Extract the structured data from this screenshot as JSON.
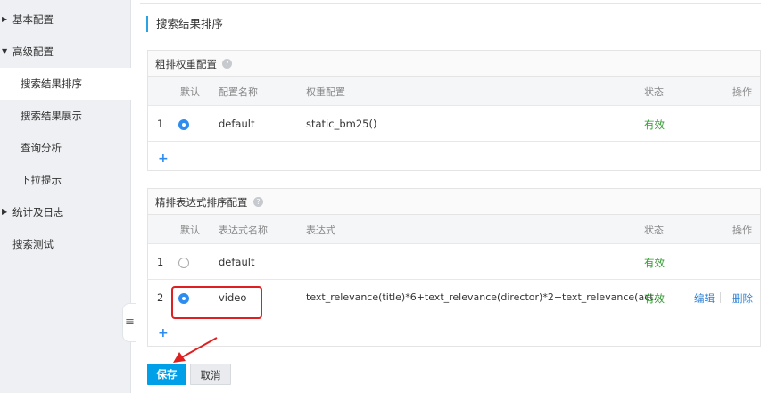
{
  "sidebar": {
    "items": [
      {
        "label": "基本配置"
      },
      {
        "label": "高级配置"
      },
      {
        "label": "搜索结果排序"
      },
      {
        "label": "搜索结果展示"
      },
      {
        "label": "查询分析"
      },
      {
        "label": "下拉提示"
      },
      {
        "label": "统计及日志"
      },
      {
        "label": "搜索测试"
      }
    ]
  },
  "page": {
    "title": "搜索结果排序"
  },
  "rough": {
    "title": "粗排权重配置",
    "headers": {
      "default": "默认",
      "name": "配置名称",
      "weight": "权重配置",
      "status": "状态",
      "action": "操作"
    },
    "rows": [
      {
        "index": "1",
        "name": "default",
        "weight": "static_bm25()",
        "status": "有效"
      }
    ]
  },
  "fine": {
    "title": "精排表达式排序配置",
    "headers": {
      "default": "默认",
      "name": "表达式名称",
      "expr": "表达式",
      "status": "状态",
      "action": "操作"
    },
    "rows": [
      {
        "index": "1",
        "name": "default",
        "expr": "",
        "status": "有效"
      },
      {
        "index": "2",
        "name": "video",
        "expr": "text_relevance(title)*6+text_relevance(director)*2+text_relevance(act...",
        "status": "有效",
        "edit": "编辑",
        "delete": "删除"
      }
    ]
  },
  "add_symbol": "+",
  "help_symbol": "?",
  "buttons": {
    "save": "保存",
    "cancel": "取消"
  },
  "colors": {
    "accent": "#00a0e9",
    "radio": "#2d8cf0",
    "valid": "#2e9c2e",
    "link": "#2a7fd4",
    "annotation": "#e02020"
  }
}
